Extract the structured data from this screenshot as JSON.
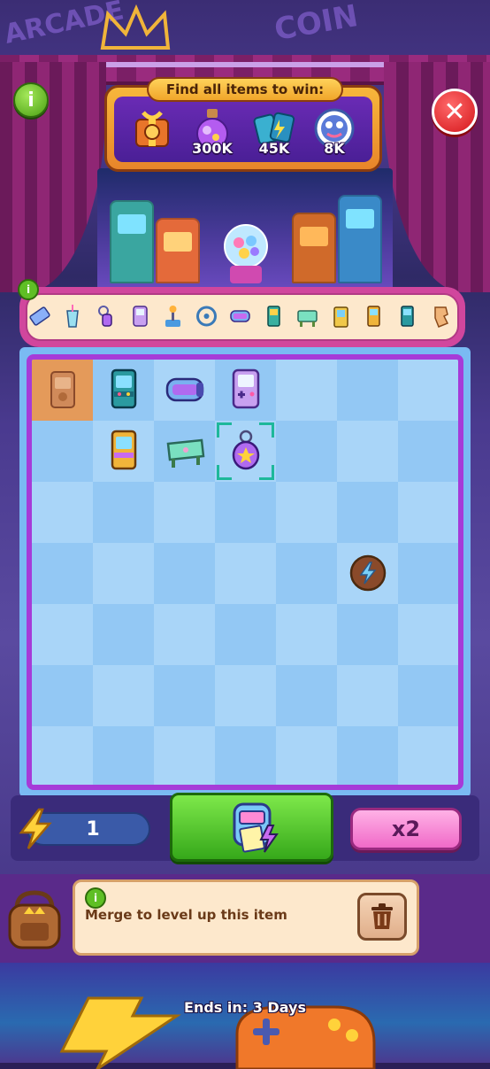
{
  "header": {
    "info_label": "i",
    "close_label": "✕"
  },
  "target_panel": {
    "title": "Find all items to win:",
    "items": [
      {
        "name": "gift-box",
        "value": ""
      },
      {
        "name": "potion-coins",
        "value": "300K"
      },
      {
        "name": "energy-cards",
        "value": "45K"
      },
      {
        "name": "pet-snacks",
        "value": "8K"
      }
    ]
  },
  "merge_chain": {
    "info_label": "i",
    "items": [
      "ticket",
      "soda-cup",
      "keychain",
      "handheld-console",
      "joystick",
      "steering-wheel",
      "vr-headset",
      "arcade-cabinet-small",
      "air-hockey-table",
      "claw-machine-toy",
      "arcade-cabinet-yellow",
      "arcade-cabinet-teal",
      "locked-item"
    ]
  },
  "board": {
    "rows": 7,
    "cols": 7,
    "items": [
      {
        "row": 0,
        "col": 0,
        "name": "arcade-cabinet-faded",
        "selected": true
      },
      {
        "row": 0,
        "col": 1,
        "name": "arcade-cabinet-teal"
      },
      {
        "row": 0,
        "col": 2,
        "name": "vr-headset"
      },
      {
        "row": 0,
        "col": 3,
        "name": "handheld-console"
      },
      {
        "row": 1,
        "col": 1,
        "name": "arcade-cabinet-yellow"
      },
      {
        "row": 1,
        "col": 2,
        "name": "air-hockey-table"
      },
      {
        "row": 1,
        "col": 3,
        "name": "keychain",
        "focused": true
      },
      {
        "row": 3,
        "col": 5,
        "name": "energy-bubble"
      }
    ]
  },
  "controls": {
    "energy_count": "1",
    "multiplier_label": "x2",
    "generator_name": "ticket-machine"
  },
  "hint": {
    "info_label": "i",
    "text": "Merge to level up this item"
  },
  "footer": {
    "ends_label": "Ends in: 3 Days"
  },
  "colors": {
    "board_border": "#a63bd8",
    "cell_light": "#a9d5f8",
    "cell_dark": "#93c8f4",
    "generator_green": "#36a81a",
    "multiplier_pink": "#f06ac8",
    "close_red": "#d4151a"
  }
}
